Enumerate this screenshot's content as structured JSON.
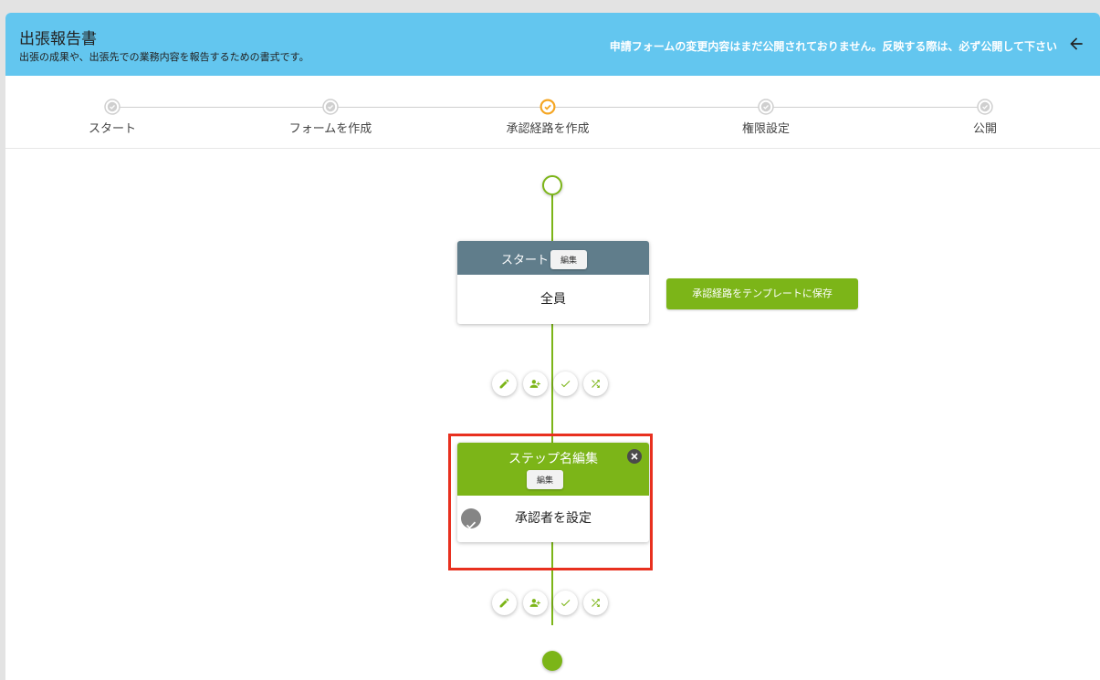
{
  "header": {
    "title": "出張報告書",
    "subtitle": "出張の成果や、出張先での業務内容を報告するための書式です。",
    "notice": "申請フォームの変更内容はまだ公開されておりません。反映する際は、必ず公開して下さい",
    "back_icon": "arrow-left-icon",
    "color": "#63c6ef"
  },
  "stepper": {
    "steps": [
      {
        "label": "スタート",
        "state": "done"
      },
      {
        "label": "フォームを作成",
        "state": "done"
      },
      {
        "label": "承認経路を作成",
        "state": "current"
      },
      {
        "label": "権限設定",
        "state": "done"
      },
      {
        "label": "公開",
        "state": "done"
      }
    ],
    "current_color": "#f5a623"
  },
  "flow": {
    "accent": "#7cb518",
    "start_card": {
      "title": "スタート",
      "edit_label": "編集",
      "body": "全員",
      "header_color": "#607d8b"
    },
    "save_template_label": "承認経路をテンプレートに保存",
    "step_card": {
      "title": "ステップ名編集",
      "edit_label": "編集",
      "body": "承認者を設定",
      "header_color": "#7cb518",
      "close_icon": "close-icon",
      "check_icon": "check-circle-icon"
    },
    "action_icons": [
      "pencil-icon",
      "add-user-icon",
      "check-icon",
      "shuffle-icon"
    ]
  }
}
